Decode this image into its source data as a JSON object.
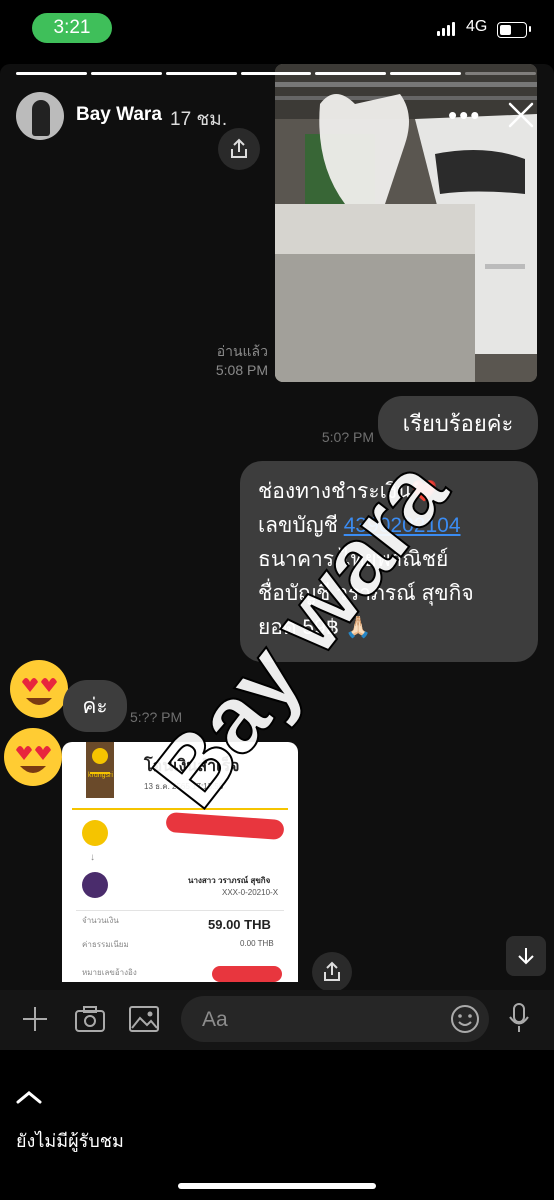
{
  "status_bar": {
    "time": "3:21",
    "network": "4G"
  },
  "story": {
    "username": "Bay Wara",
    "time_ago": "17 ชม.",
    "watermark": "Bay wara"
  },
  "chat": {
    "read_label": "อ่านแล้ว",
    "read_time": "5:08 PM",
    "ts2": "5:0? PM",
    "msg1": "เรียบร้อยค่ะ",
    "msg2": {
      "line1": "ช่องทางชำระเงิน❤️",
      "line2_prefix": "เลขบัญชี ",
      "account_number": "4390202104",
      "line3": "ธนาคาร ไทยพาณิชย์",
      "line4": "ชื่อบัญชี  วราภรณ์ สุขกิจ",
      "line5": "ยอด 59฿ 🙏🏻"
    },
    "msg3": "ค่ะ",
    "ts3": "5:?? PM"
  },
  "receipt": {
    "bank_name": "krungsri",
    "title": "โอนเงินสำเร็จ",
    "date": "13 ธ.ค. 2565 17:13:56",
    "recipient_name": "นางสาว วราภรณ์ สุขกิจ",
    "recipient_account": "XXX-0-20210-X",
    "amount_label": "จำนวนเงิน",
    "amount": "59.00 THB",
    "fee_label": "ค่าธรรมเนียม",
    "fee": "0.00 THB",
    "ref_label": "หมายเลขอ้างอิง"
  },
  "input": {
    "placeholder": "Aa"
  },
  "footer": {
    "viewers_text": "ยังไม่มีผู้รับชม"
  },
  "colors": {
    "accent_green": "#3fbf5a",
    "link_blue": "#3b8cf2",
    "bubble": "#3d3d3d",
    "krungsri_yellow": "#f5c400"
  }
}
